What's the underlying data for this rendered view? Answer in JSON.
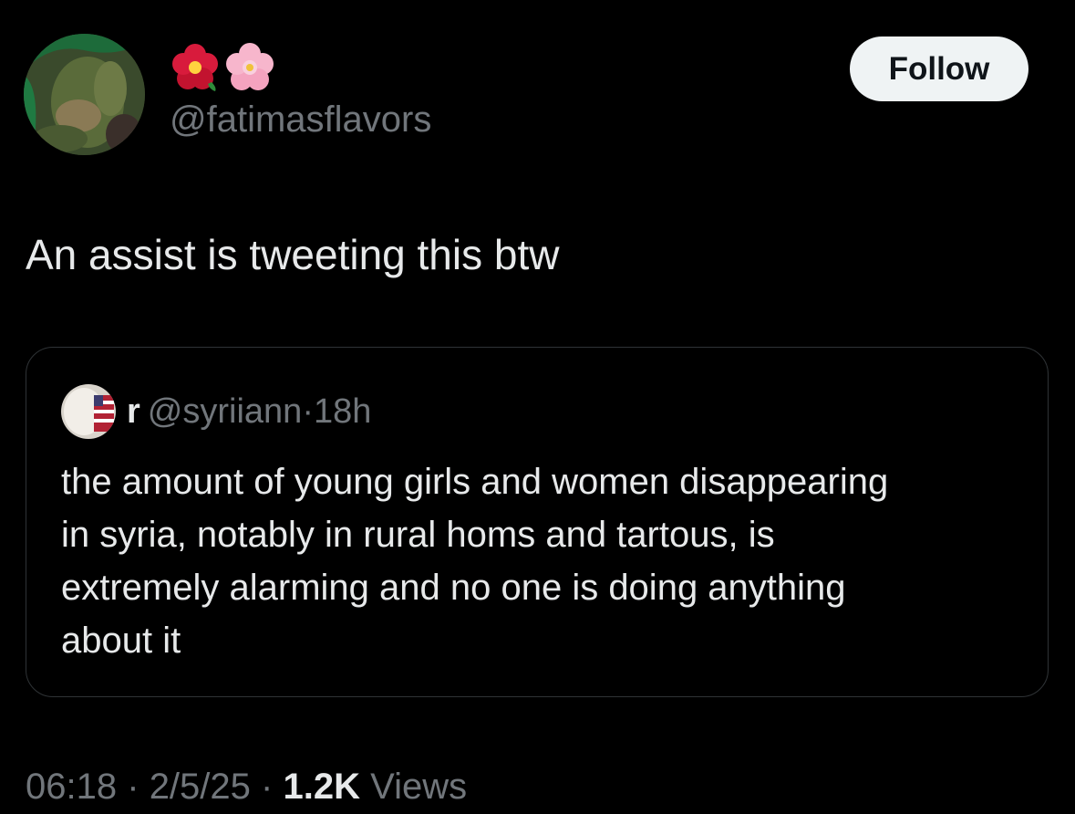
{
  "author": {
    "display_name_icons": [
      "hibiscus-icon",
      "cherry-blossom-icon"
    ],
    "handle": "@fatimasflavors"
  },
  "follow_button": {
    "label": "Follow"
  },
  "tweet": {
    "text": "An assist is tweeting this btw"
  },
  "quoted_tweet": {
    "name": "r",
    "handle": "@syriiann",
    "separator": "·",
    "time": "18h",
    "lines": [
      "the amount of young girls and women disappearing",
      "in syria, notably in rural homs and tartous, is",
      "extremely alarming and no one is doing anything",
      "about it"
    ]
  },
  "meta": {
    "time": "06:18",
    "separator": "·",
    "date": "2/5/25",
    "views_count": "1.2K",
    "views_label": "Views"
  },
  "colors": {
    "background": "#000000",
    "text_primary": "#e7e9ea",
    "text_secondary": "#71767b",
    "border": "#2f3336",
    "follow_bg": "#eff3f4"
  }
}
